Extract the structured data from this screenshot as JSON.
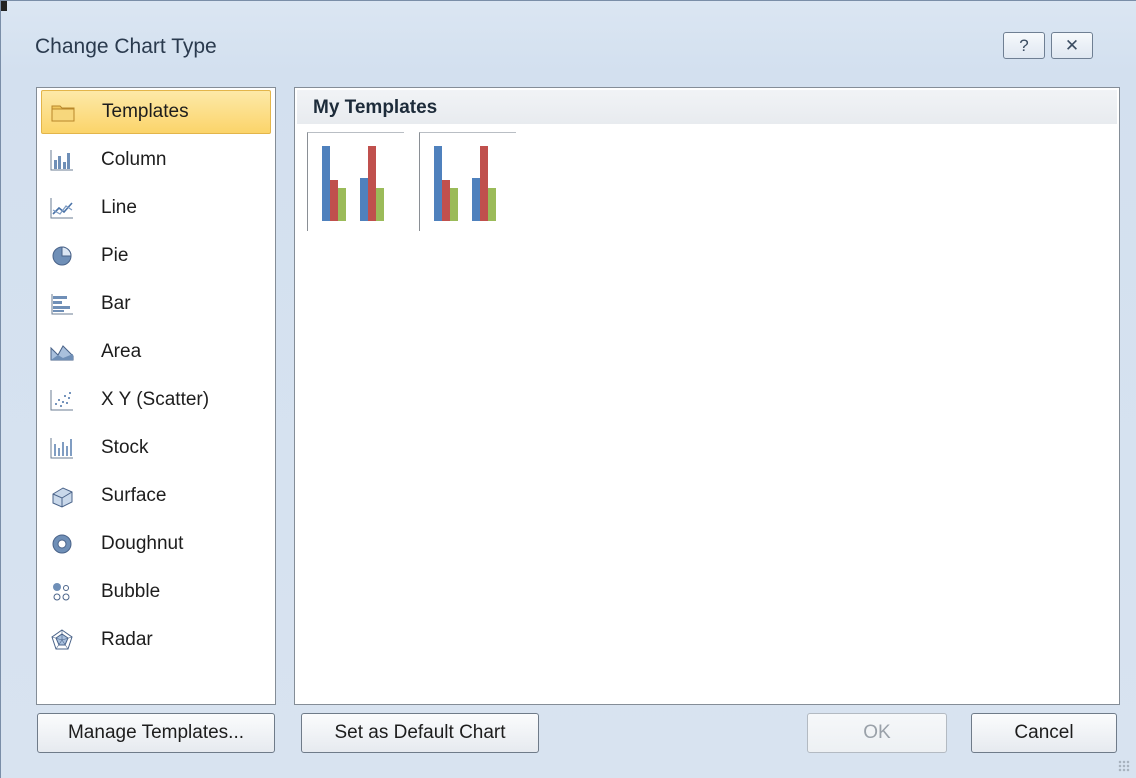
{
  "window": {
    "title": "Change Chart Type",
    "help_icon": "help-question-icon",
    "close_icon": "close-x-icon"
  },
  "chart_types": [
    {
      "label": "Templates",
      "icon": "folder-icon",
      "selected": true
    },
    {
      "label": "Column",
      "icon": "column-chart-icon"
    },
    {
      "label": "Line",
      "icon": "line-chart-icon"
    },
    {
      "label": "Pie",
      "icon": "pie-chart-icon"
    },
    {
      "label": "Bar",
      "icon": "bar-chart-icon"
    },
    {
      "label": "Area",
      "icon": "area-chart-icon"
    },
    {
      "label": "X Y (Scatter)",
      "icon": "scatter-chart-icon"
    },
    {
      "label": "Stock",
      "icon": "stock-chart-icon"
    },
    {
      "label": "Surface",
      "icon": "surface-chart-icon"
    },
    {
      "label": "Doughnut",
      "icon": "doughnut-chart-icon"
    },
    {
      "label": "Bubble",
      "icon": "bubble-chart-icon"
    },
    {
      "label": "Radar",
      "icon": "radar-chart-icon"
    }
  ],
  "templates": {
    "header": "My Templates",
    "items_icon": "clustered-column-template-icon",
    "colors": {
      "series1": "#4f81bd",
      "series2": "#c0504d",
      "series3": "#9bbb59"
    }
  },
  "buttons": {
    "manage_templates": "Manage Templates...",
    "set_default": "Set as Default Chart",
    "ok": "OK",
    "cancel": "Cancel"
  },
  "colors": {
    "selection": "#fbd46a",
    "dialog_bg": "#d8e3f0"
  }
}
